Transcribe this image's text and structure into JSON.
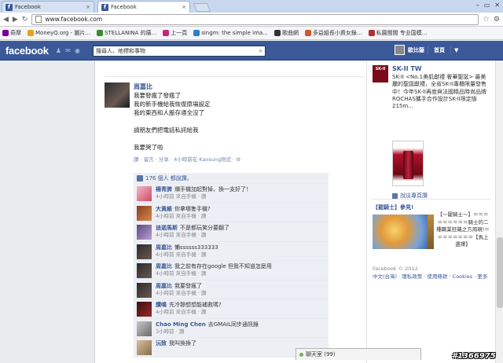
{
  "browser": {
    "tabs": [
      {
        "label": "Facebook",
        "active": false
      },
      {
        "label": "Facebook",
        "active": true
      }
    ],
    "url": "www.facebook.com",
    "bookmarks": [
      {
        "label": "奇摩",
        "color": "#7b0099"
      },
      {
        "label": "MoneyQ.org - 圖片...",
        "color": "#e8a21a"
      },
      {
        "label": "STELLANINA 的痛...",
        "color": "#3c8a2e"
      },
      {
        "label": "上一頁",
        "color": "#c0287f"
      },
      {
        "label": "singm: the simple ima...",
        "color": "#2a7fcf"
      },
      {
        "label": "歌曲網",
        "color": "#333333"
      },
      {
        "label": "多益組長小資女錄...",
        "color": "#d4562a"
      },
      {
        "label": "私園閩閩 专业国模...",
        "color": "#b03030"
      }
    ]
  },
  "header": {
    "logo": "facebook",
    "search_placeholder": "搜尋人、地標和事物",
    "user_name": "歐比薩",
    "home_label": "首頁"
  },
  "post": {
    "author": "周嘉比",
    "lines": [
      "我要發瘋了發瘋了",
      "我的新手機給我恢復原場設定",
      "我的東西和人脈存通全沒了",
      "",
      "請朋友們把電話私訊給我",
      "",
      "我要哭了啦"
    ],
    "meta": "讚 · 留言 · 分享 · 4小時前在 Kaosung附近 ·",
    "likes_text": "176 個人 都說讚。"
  },
  "comments": [
    {
      "name": "楊青脾",
      "text": "爛手機加起對掉，換一支好了！",
      "meta": "4小時前 來自手機 · 讚",
      "avatar": [
        "#f2b7c7",
        "#d04a6a"
      ]
    },
    {
      "name": "大黃維",
      "text": "你拿哪隻手機?",
      "meta": "4小時前 來自手機 · 讚",
      "avatar": [
        "#8c3d20",
        "#d48a4a"
      ]
    },
    {
      "name": "迪迦馬斯",
      "text": "不是都玩笑分要翻了",
      "meta": "4小時前 來自手機 · 讚",
      "avatar": [
        "#5a4a7a",
        "#b9a0d8"
      ]
    },
    {
      "name": "周嘉比",
      "text": "懶ssssss333333",
      "meta": "4小時前 來自手機 · 讚",
      "avatar": [
        "#2b2b2b",
        "#6a5a52"
      ]
    },
    {
      "name": "周嘉比",
      "text": "我之前有存在google 但我不知道怎麼用",
      "meta": "4小時前 來自手機 · 讚",
      "avatar": [
        "#2b2b2b",
        "#6a5a52"
      ]
    },
    {
      "name": "周嘉比",
      "text": "我要發瘋了",
      "meta": "4小時前 來自手機 · 讚",
      "avatar": [
        "#2b2b2b",
        "#6a5a52"
      ]
    },
    {
      "name": "讚鳴",
      "text": "先冷靜想想能補救嗎?",
      "meta": "4小時前 來自手機 · 讚",
      "avatar": [
        "#3a1010",
        "#9a2a2a"
      ]
    },
    {
      "name": "Chao Ming Chen",
      "text": "去GMAIL同步通訊錄",
      "meta": "3小時前 · 讚",
      "avatar": [
        "#c8c8c8",
        "#6a6a6a"
      ]
    },
    {
      "name": "沅致",
      "text": "我叫換換了",
      "meta": "",
      "avatar": [
        "#d8c0a0",
        "#8a6a4a"
      ]
    }
  ],
  "sidebar": {
    "ad1": {
      "logo": "SK-II",
      "title": "SK-II TW",
      "text": "SK-II <No.1美肌獻禮 奢華聖誕> 最美麗的聖誕獻禮，全省SK-II專櫃限量發售中！今年SK-II再度與法國精品時尚品牌ROCHAS攜手合作設計SK-II限定版215m...",
      "share": "說這專頁讚"
    },
    "ad2": {
      "title": "【罷騎士】參見!",
      "text": "【～罷騎士～】＝＝＝＝＝＝＝＝＝騎士的二種職業狂飆之方周現!＝＝＝＝＝＝＝＝【馬上選擇】"
    },
    "footer": {
      "copyright": "Facebook © 2012",
      "links": "中文(台灣) · 隱私政策 · 使用條款 · Cookies · 更多"
    }
  },
  "chat": {
    "label": "聊天室 (99)"
  },
  "watermark": "#1366975"
}
